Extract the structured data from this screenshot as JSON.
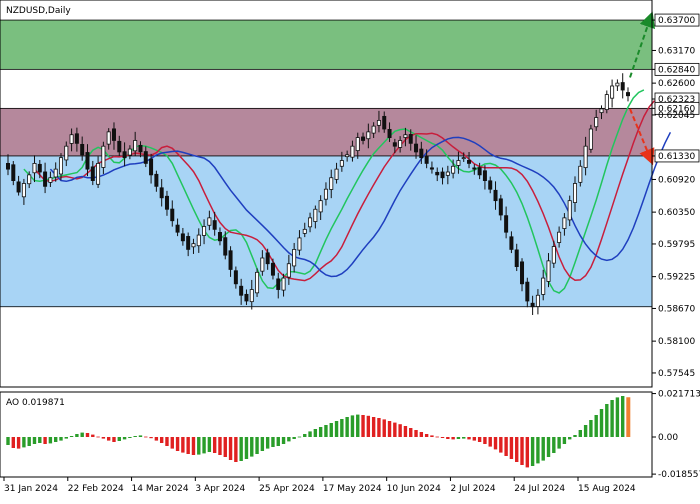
{
  "window": {
    "symbol_label": "NZDUSD,Daily"
  },
  "colors": {
    "resistance_zone": "#b5889c",
    "support_zone": "#a8d4f5",
    "target_zone": "#7abf7f",
    "candle": "#111111",
    "ma_fast": "#22c55e",
    "ma_mid": "#c81e3c",
    "ma_slow": "#1f3fbf",
    "arrow_up": "#1a8a2a",
    "arrow_down": "#e8331a",
    "ao_up": "#2a9d2a",
    "ao_down": "#e02020",
    "ao_last": "#f08030"
  },
  "chart_data": [
    {
      "type": "candlestick",
      "symbol": "NZDUSD",
      "timeframe": "Daily",
      "ylim": [
        0.573,
        0.6405
      ],
      "grid": false,
      "y_ticks": [
        "0.63700",
        "0.63170",
        "0.62840",
        "0.62600",
        "0.62323",
        "0.62160",
        "0.62045",
        "0.61330",
        "0.60920",
        "0.60350",
        "0.59795",
        "0.59225",
        "0.58670",
        "0.58100",
        "0.57545"
      ],
      "highlighted_levels": [
        "0.63700",
        "0.62840",
        "0.62323",
        "0.62160",
        "0.61330"
      ],
      "x_ticks": [
        "31 Jan 2024",
        "22 Feb 2024",
        "14 Mar 2024",
        "3 Apr 2024",
        "25 Apr 2024",
        "17 May 2024",
        "10 Jun 2024",
        "2 Jul 2024",
        "24 Jul 2024",
        "15 Aug 2024"
      ],
      "zones": [
        {
          "name": "target",
          "from": 0.6284,
          "to": 0.637
        },
        {
          "name": "resistance",
          "from": 0.6133,
          "to": 0.6216
        },
        {
          "name": "support",
          "from": 0.587,
          "to": 0.6133
        }
      ],
      "closes": [
        0.611,
        0.609,
        0.607,
        0.6085,
        0.61,
        0.612,
        0.6105,
        0.608,
        0.6095,
        0.611,
        0.613,
        0.615,
        0.617,
        0.6155,
        0.6135,
        0.611,
        0.609,
        0.612,
        0.615,
        0.6175,
        0.616,
        0.614,
        0.613,
        0.6145,
        0.616,
        0.614,
        0.612,
        0.61,
        0.608,
        0.606,
        0.604,
        0.602,
        0.6,
        0.5985,
        0.597,
        0.598,
        0.5995,
        0.601,
        0.6025,
        0.6005,
        0.5985,
        0.596,
        0.5935,
        0.591,
        0.589,
        0.588,
        0.59,
        0.593,
        0.5955,
        0.5945,
        0.5925,
        0.59,
        0.592,
        0.5945,
        0.597,
        0.599,
        0.6005,
        0.6025,
        0.604,
        0.6055,
        0.6075,
        0.6095,
        0.611,
        0.6125,
        0.6135,
        0.615,
        0.6165,
        0.616,
        0.6175,
        0.6185,
        0.6195,
        0.618,
        0.6165,
        0.615,
        0.616,
        0.617,
        0.6155,
        0.614,
        0.613,
        0.612,
        0.611,
        0.61,
        0.6095,
        0.6105,
        0.6115,
        0.6125,
        0.613,
        0.612,
        0.611,
        0.61,
        0.609,
        0.6075,
        0.6055,
        0.603,
        0.6,
        0.597,
        0.594,
        0.591,
        0.588,
        0.587,
        0.589,
        0.592,
        0.595,
        0.5975,
        0.6,
        0.6025,
        0.6055,
        0.6085,
        0.6115,
        0.615,
        0.618,
        0.62,
        0.6215,
        0.624,
        0.6255,
        0.626,
        0.6248,
        0.6238
      ]
    },
    {
      "type": "bar",
      "title": "AO 0.019871",
      "ylim": [
        -0.02,
        0.0225
      ],
      "y_ticks": [
        "0.021713",
        "0.00",
        "-0.018557"
      ],
      "values": [
        -0.004,
        -0.0055,
        -0.0058,
        -0.0052,
        -0.0045,
        -0.0035,
        -0.003,
        -0.0035,
        -0.0032,
        -0.0025,
        -0.0018,
        -0.0008,
        0.0005,
        0.0015,
        0.0022,
        0.002,
        0.0012,
        0.0002,
        -0.0008,
        -0.0018,
        -0.0025,
        -0.002,
        -0.0012,
        -0.0005,
        0.0005,
        0.0008,
        0.0002,
        -0.0006,
        -0.0018,
        -0.003,
        -0.0045,
        -0.0058,
        -0.007,
        -0.0078,
        -0.0085,
        -0.009,
        -0.0088,
        -0.0082,
        -0.0075,
        -0.008,
        -0.009,
        -0.01,
        -0.0115,
        -0.0125,
        -0.012,
        -0.011,
        -0.0098,
        -0.0085,
        -0.007,
        -0.0058,
        -0.005,
        -0.0045,
        -0.0035,
        -0.0022,
        -0.001,
        0.0002,
        0.0015,
        0.0028,
        0.004,
        0.005,
        0.006,
        0.007,
        0.008,
        0.009,
        0.01,
        0.0108,
        0.0112,
        0.011,
        0.0106,
        0.01,
        0.0095,
        0.0088,
        0.008,
        0.0072,
        0.0064,
        0.0055,
        0.0045,
        0.0035,
        0.0025,
        0.0015,
        0.0008,
        0.0002,
        -0.0005,
        -0.001,
        -0.0012,
        -0.001,
        -0.0008,
        -0.0012,
        -0.0018,
        -0.0025,
        -0.0035,
        -0.0048,
        -0.0062,
        -0.0078,
        -0.0095,
        -0.011,
        -0.0125,
        -0.014,
        -0.0152,
        -0.0145,
        -0.0132,
        -0.0118,
        -0.01,
        -0.008,
        -0.0058,
        -0.0035,
        -0.0012,
        0.001,
        0.0035,
        0.006,
        0.0085,
        0.011,
        0.014,
        0.0165,
        0.0185,
        0.0198,
        0.0205,
        0.019871
      ]
    }
  ]
}
